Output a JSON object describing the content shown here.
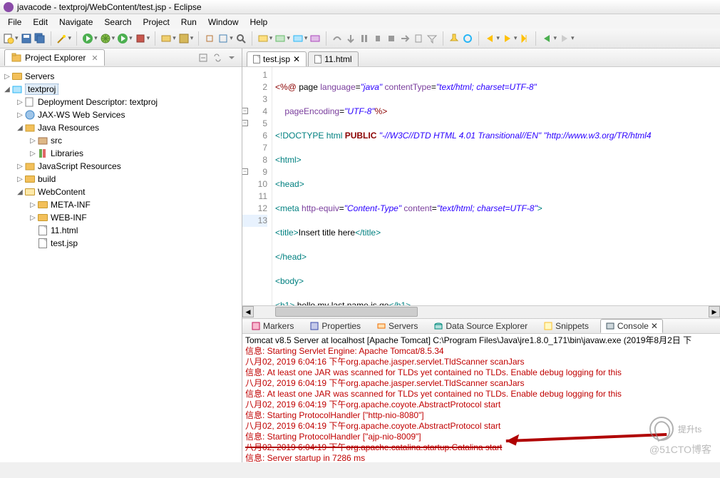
{
  "window": {
    "title": "javacode - textproj/WebContent/test.jsp - Eclipse"
  },
  "menu": [
    "File",
    "Edit",
    "Navigate",
    "Search",
    "Project",
    "Run",
    "Window",
    "Help"
  ],
  "project_explorer": {
    "title": "Project Explorer",
    "tree": {
      "servers": "Servers",
      "project": "textproj",
      "dd": "Deployment Descriptor: textproj",
      "jaxws": "JAX-WS Web Services",
      "javares": "Java Resources",
      "src": "src",
      "libs": "Libraries",
      "jsres": "JavaScript Resources",
      "build": "build",
      "webcontent": "WebContent",
      "metainf": "META-INF",
      "webinf": "WEB-INF",
      "file1": "11.html",
      "file2": "test.jsp"
    }
  },
  "editor": {
    "tabs": {
      "active": "test.jsp",
      "inactive": "11.html"
    },
    "lines": {
      "l1a": "<%@",
      "l1b": " page ",
      "l1c": "language",
      "l1d": "=",
      "l1e": "\"java\"",
      "l1f": " contentType",
      "l1g": "=",
      "l1h": "\"text/html; charset=UTF-8\"",
      "l2a": "    pageEncoding",
      "l2b": "=",
      "l2c": "\"UTF-8\"",
      "l2d": "%>",
      "l3a": "<!",
      "l3b": "DOCTYPE ",
      "l3c": "html ",
      "l3d": "PUBLIC ",
      "l3e": "\"-//W3C//DTD HTML 4.01 Transitional//EN\"",
      "l3f": " ",
      "l3g": "\"http://www.w3.org/TR/html4",
      "l4": "<html>",
      "l5": "<head>",
      "l6a": "<meta ",
      "l6b": "http-equiv",
      "l6c": "=",
      "l6d": "\"Content-Type\"",
      "l6e": " content",
      "l6f": "=",
      "l6g": "\"text/html; charset=UTF-8\"",
      "l6h": ">",
      "l7a": "<title>",
      "l7b": "Insert title here",
      "l7c": "</title>",
      "l8": "</head>",
      "l9": "<body>",
      "l10a": "<h1>",
      "l10b": " hello,my last name is ge",
      "l10c": "</h1>",
      "l11": "",
      "l12": "</body>",
      "l13": "</html>"
    }
  },
  "bottom_tabs": {
    "markers": "Markers",
    "properties": "Properties",
    "servers": "Servers",
    "dse": "Data Source Explorer",
    "snippets": "Snippets",
    "console": "Console"
  },
  "console": {
    "title": "Tomcat v8.5 Server at localhost [Apache Tomcat] C:\\Program Files\\Java\\jre1.8.0_171\\bin\\javaw.exe (2019年8月2日 下",
    "l1": "信息: Starting Servlet Engine: Apache Tomcat/8.5.34",
    "l2": "八月02, 2019 6:04:16 下午org.apache.jasper.servlet.TldScanner scanJars",
    "l3": "信息: At least one JAR was scanned for TLDs yet contained no TLDs. Enable debug logging for this",
    "l4": "八月02, 2019 6:04:19 下午org.apache.jasper.servlet.TldScanner scanJars",
    "l5": "信息: At least one JAR was scanned for TLDs yet contained no TLDs. Enable debug logging for this",
    "l6": "八月02, 2019 6:04:19 下午org.apache.coyote.AbstractProtocol start",
    "l7": "信息: Starting ProtocolHandler [\"http-nio-8080\"]",
    "l8": "八月02, 2019 6:04:19 下午org.apache.coyote.AbstractProtocol start",
    "l9": "信息: Starting ProtocolHandler [\"ajp-nio-8009\"]",
    "l10": "八月02, 2019 6:04:19 下午org.apache.catalina.startup.Catalina start",
    "l11": "信息: Server startup in 7286 ms"
  },
  "watermark": {
    "main": "提升ts",
    "sub": "@51CTO博客"
  }
}
